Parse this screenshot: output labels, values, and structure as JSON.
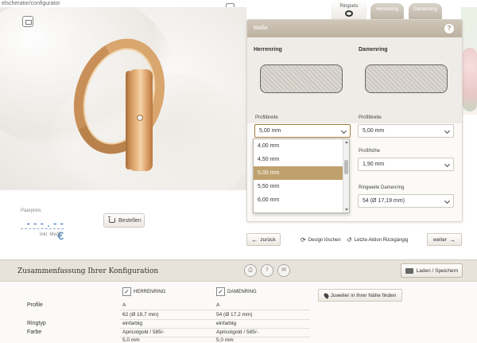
{
  "browser": {
    "url_fragment": "elscherator/configurator"
  },
  "hero": {
    "alt": ""
  },
  "price": {
    "label": "Paarpreis",
    "value": "- - - . - - €",
    "tax_note": "inkl. MwSt."
  },
  "order": {
    "label": "Bestellen"
  },
  "tabs": [
    {
      "label": "Ringsets",
      "active": true
    },
    {
      "label": "Herrenring",
      "active": false
    },
    {
      "label": "Damenring",
      "active": false
    }
  ],
  "panel": {
    "title": "Maße",
    "help": "?",
    "herrenring_title": "Herrenring",
    "damenring_title": "Damenring",
    "left": {
      "profilbreite_label": "Profilbreite",
      "profilbreite_value": "5,00 mm",
      "dropdown_options": [
        "4,00 mm",
        "4,50 mm",
        "5,00 mm",
        "5,50 mm",
        "6,00 mm"
      ],
      "dropdown_selected_index": 2
    },
    "right": {
      "profilbreite_label": "Profilbreite",
      "profilbreite_value": "5,00 mm",
      "profilhoehe_label": "Profilhöhe",
      "profilhoehe_value": "1,90 mm",
      "ringweite_label": "Ringweite Damenring",
      "ringweite_value": "54 (Ø 17,19 mm)"
    }
  },
  "nav": {
    "back": "zurück",
    "clear": "Design löschen",
    "undo": "Letzte Aktion Rückgängig",
    "next": "weiter"
  },
  "summary": {
    "title": "Zusammenfassung Ihrer Konfiguration",
    "share_icons": [
      "print-icon",
      "facebook-icon",
      "mail-icon"
    ],
    "load_save": "Laden / Speichern",
    "col_herren": "HERRENRING",
    "col_damen": "DAMENRING",
    "jeweler": "Juwelier in Ihrer Nähe finden",
    "rows": [
      {
        "label": "Profile",
        "herren": "A",
        "damen": "A"
      },
      {
        "label": "",
        "herren": "62 (Ø 19,7 mm)",
        "damen": "54 (Ø 17,2 mm)"
      },
      {
        "label": "Ringtyp",
        "herren": "einfarbig",
        "damen": "einfarbig"
      },
      {
        "label": "Farbe",
        "herren": "Apricotgold / 585/-",
        "damen": "Apricotgold / 585/-"
      },
      {
        "label": "",
        "herren": "5,0 mm",
        "damen": "5,0 mm"
      }
    ]
  },
  "colors": {
    "accent": "#bfa16e",
    "panel_head": "#c7bdae",
    "summary_bar": "#e8e3da"
  }
}
